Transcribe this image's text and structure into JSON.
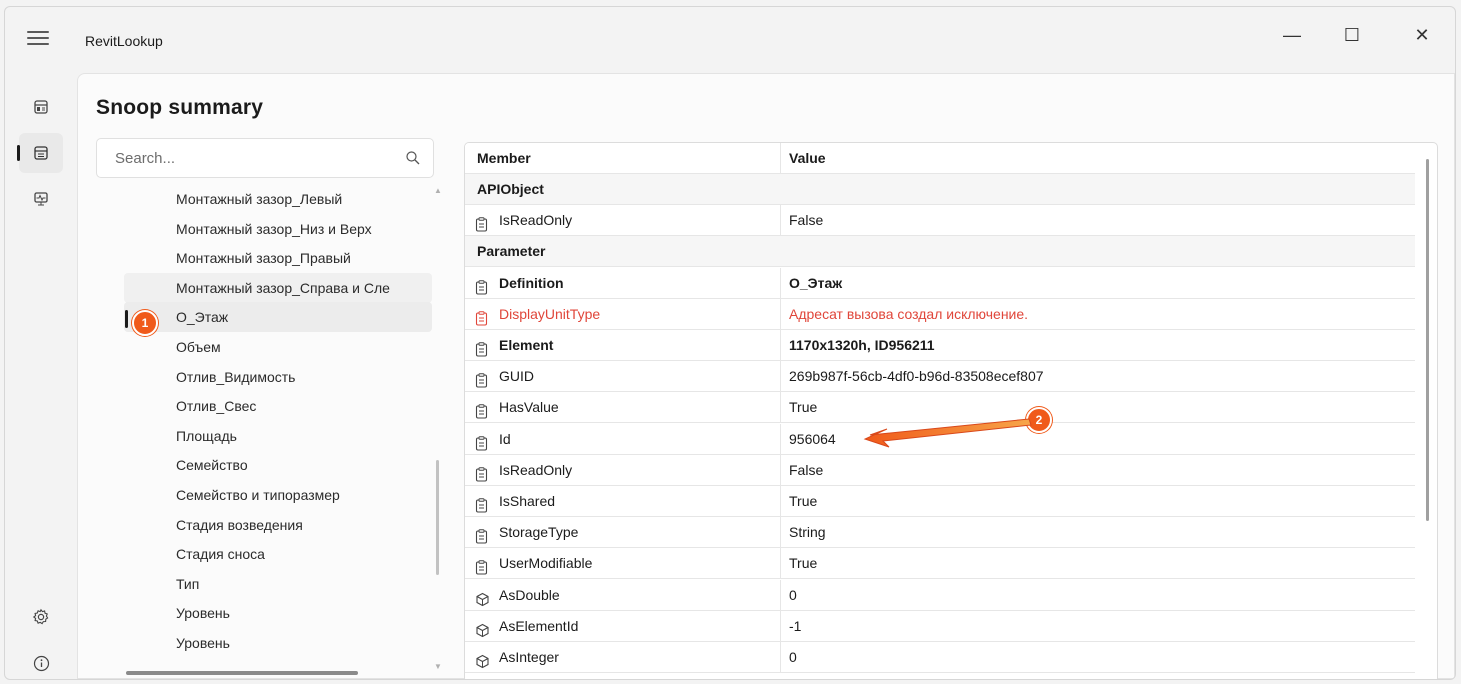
{
  "app": {
    "title": "RevitLookup"
  },
  "window_controls": {
    "minimize": "—",
    "maximize": "☐",
    "close": "✕"
  },
  "nav": [
    {
      "icon": "dashboard-icon",
      "active": false
    },
    {
      "icon": "snoop-summary-icon",
      "active": true
    },
    {
      "icon": "events-monitor-icon",
      "active": false
    },
    {
      "icon": "settings-icon",
      "active": false
    },
    {
      "icon": "info-icon",
      "active": false
    }
  ],
  "page": {
    "title": "Snoop summary"
  },
  "search": {
    "placeholder": "Search..."
  },
  "tree": {
    "items": [
      "Монтажный зазор_Левый",
      "Монтажный зазор_Низ и Верх",
      "Монтажный зазор_Правый",
      "Монтажный зазор_Справа и Сле",
      "О_Этаж",
      "Объем",
      "Отлив_Видимость",
      "Отлив_Свес",
      "Площадь",
      "Семейство",
      "Семейство и типоразмер",
      "Стадия возведения",
      "Стадия сноса",
      "Тип",
      "Уровень",
      "Уровень"
    ],
    "selected_index": 4
  },
  "grid": {
    "headers": {
      "member": "Member",
      "value": "Value"
    },
    "rows": [
      {
        "type": "group",
        "member": "APIObject"
      },
      {
        "type": "property",
        "member": "IsReadOnly",
        "value": "False"
      },
      {
        "type": "group",
        "member": "Parameter"
      },
      {
        "type": "property",
        "member": "Definition",
        "value": "О_Этаж",
        "style": "bold"
      },
      {
        "type": "property",
        "member": "DisplayUnitType",
        "value": "Адресат вызова создал исключение.",
        "style": "error"
      },
      {
        "type": "property",
        "member": "Element",
        "value": "1170x1320h, ID956211",
        "style": "bold"
      },
      {
        "type": "property",
        "member": "GUID",
        "value": "269b987f-56cb-4df0-b96d-83508ecef807"
      },
      {
        "type": "property",
        "member": "HasValue",
        "value": "True"
      },
      {
        "type": "property",
        "member": "Id",
        "value": "956064"
      },
      {
        "type": "property",
        "member": "IsReadOnly",
        "value": "False"
      },
      {
        "type": "property",
        "member": "IsShared",
        "value": "True"
      },
      {
        "type": "property",
        "member": "StorageType",
        "value": "String"
      },
      {
        "type": "property",
        "member": "UserModifiable",
        "value": "True"
      },
      {
        "type": "method",
        "member": "AsDouble",
        "value": "0"
      },
      {
        "type": "method",
        "member": "AsElementId",
        "value": "-1"
      },
      {
        "type": "method",
        "member": "AsInteger",
        "value": "0"
      }
    ]
  },
  "annotations": [
    {
      "label": "1",
      "color": "#f05a1a"
    },
    {
      "label": "2",
      "color": "#f05a1a"
    }
  ]
}
